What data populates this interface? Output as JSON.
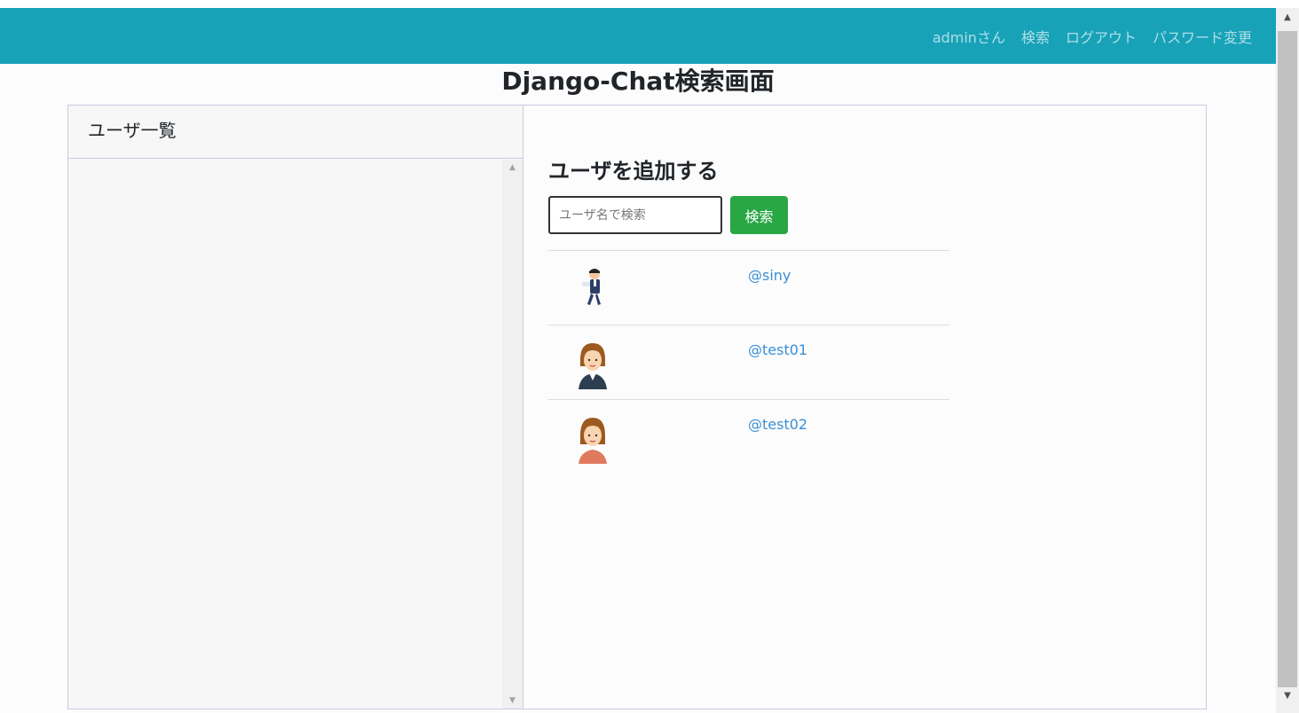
{
  "nav": {
    "user_label": "adminさん",
    "search_label": "検索",
    "logout_label": "ログアウト",
    "password_label": "パスワード変更"
  },
  "page_title": "Django-Chat検索画面",
  "left_panel": {
    "header": "ユーザ一覧"
  },
  "right_panel": {
    "add_title": "ユーザを追加する",
    "search_placeholder": "ユーザ名で検索",
    "search_button": "検索",
    "users": [
      {
        "username": "@siny"
      },
      {
        "username": "@test01"
      },
      {
        "username": "@test02"
      }
    ]
  },
  "colors": {
    "navbar": "#17a2b8",
    "button": "#28a745",
    "link": "#3a8fd6"
  }
}
